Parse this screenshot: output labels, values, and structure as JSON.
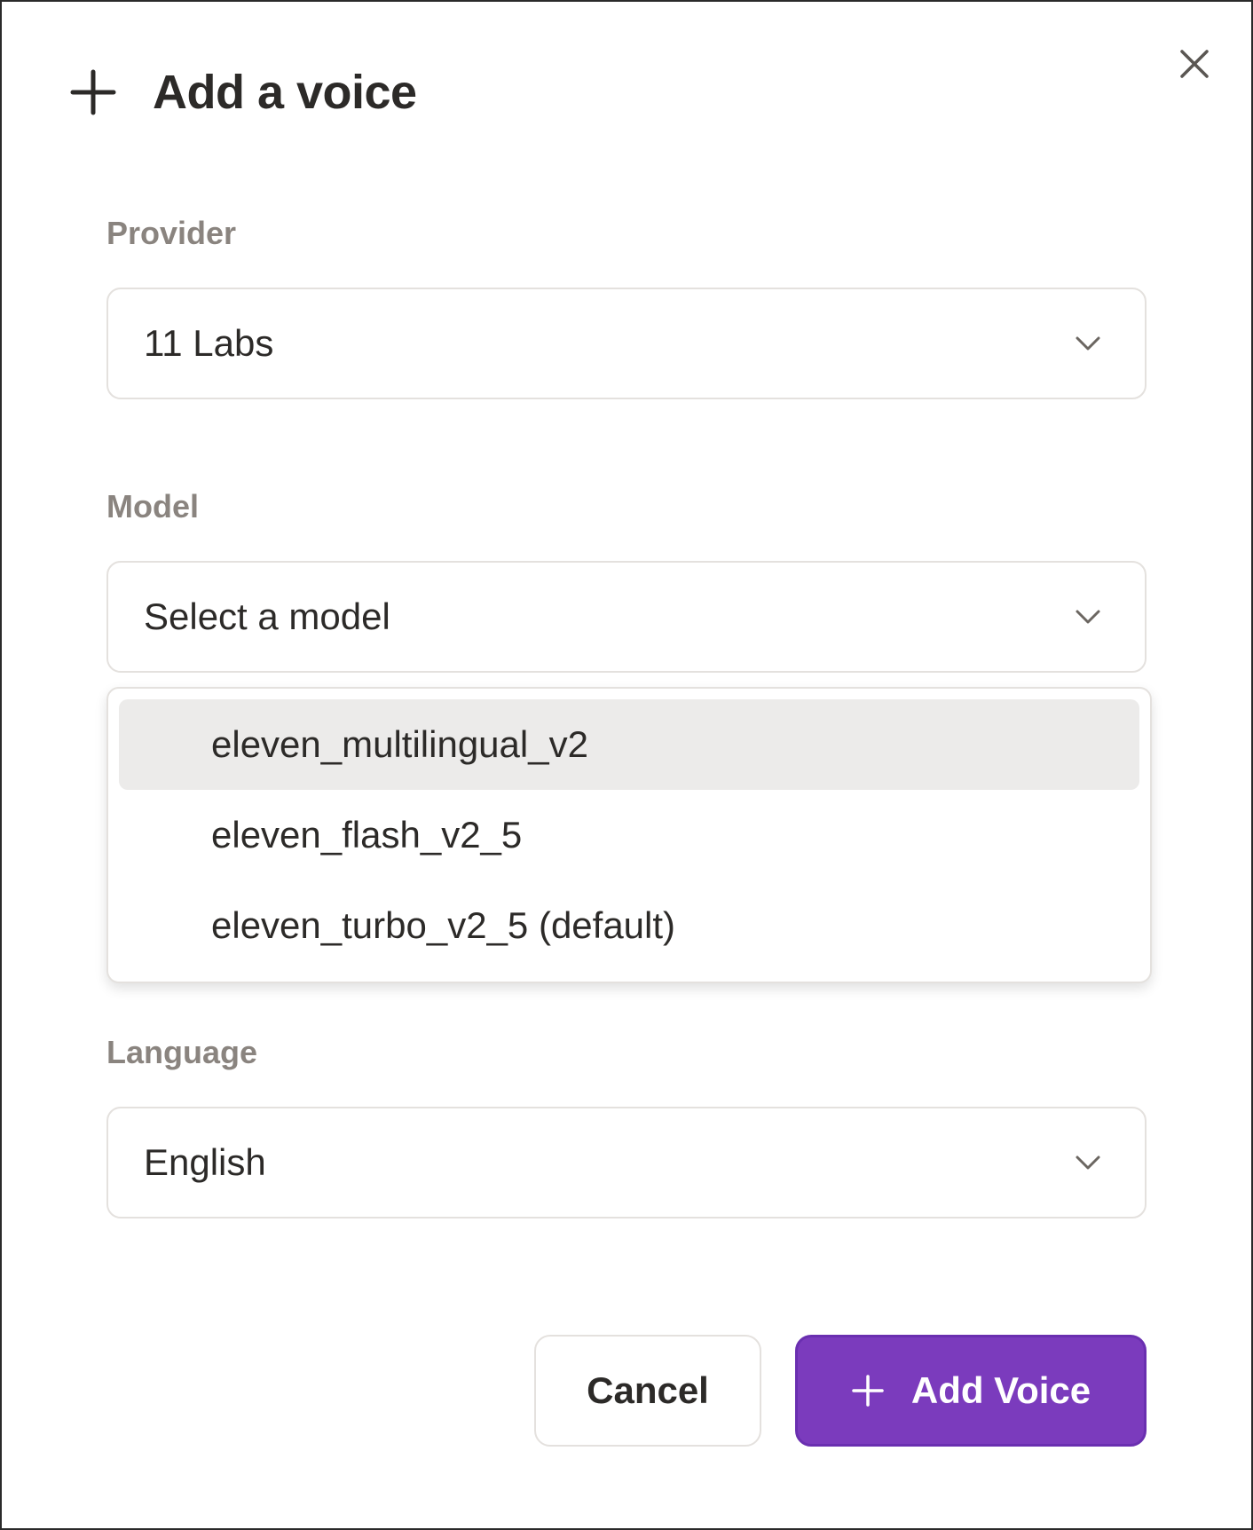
{
  "dialog": {
    "title": "Add a voice",
    "title_icon": "plus-icon",
    "close_icon": "close-icon"
  },
  "provider": {
    "label": "Provider",
    "value": "11 Labs",
    "icon": "chevron-down-icon"
  },
  "model": {
    "label": "Model",
    "placeholder": "Select a model",
    "icon": "chevron-down-icon",
    "options": [
      {
        "label": "eleven_multilingual_v2",
        "highlighted": true
      },
      {
        "label": "eleven_flash_v2_5",
        "highlighted": false
      },
      {
        "label": "eleven_turbo_v2_5 (default)",
        "highlighted": false
      }
    ]
  },
  "language": {
    "label": "Language",
    "value": "English",
    "icon": "chevron-down-icon"
  },
  "actions": {
    "cancel_label": "Cancel",
    "add_label": "Add Voice",
    "add_icon": "plus-icon"
  },
  "colors": {
    "primary": "#7b3bbd",
    "label_text": "#8a847f",
    "body_text": "#2c2a28",
    "highlight_bg": "#ecebea",
    "border": "#e4e1de"
  }
}
